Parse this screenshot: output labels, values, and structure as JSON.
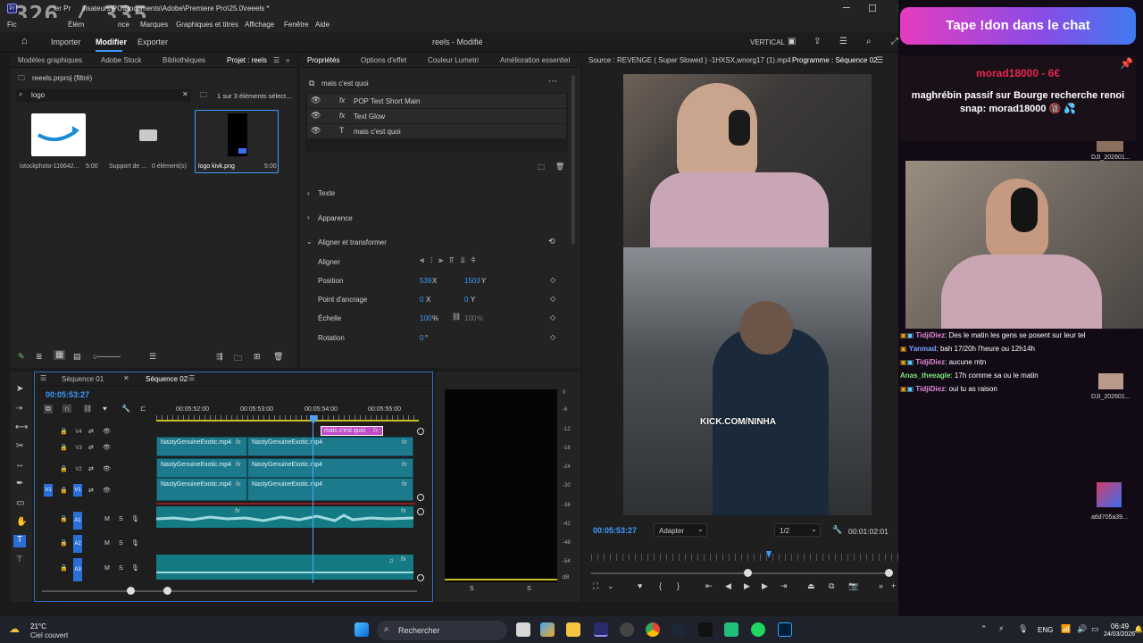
{
  "overlay": {
    "counter": "326 / 335"
  },
  "window": {
    "title_fragment": "ilisateurs\\PC\\Documents\\Adobe\\Premiere Pro\\25.0\\reeels *",
    "prefix": "ier Pr"
  },
  "menu": {
    "items": [
      "Fic",
      "Élém",
      "nce",
      "Marques",
      "Graphiques et titres",
      "Affichage",
      "Fenêtre",
      "Aide"
    ]
  },
  "workspace": {
    "tabs": [
      "Importer",
      "Modifier",
      "Exporter"
    ],
    "project_title": "reels - Modifié",
    "layout": "VERTICAL"
  },
  "project_panel": {
    "tabs": [
      "Modèles graphiques",
      "Adobe Stock",
      "Bibliothèques",
      "Projet : reels"
    ],
    "project_file": "reeels.prproj (filtré)",
    "search_value": "logo",
    "count_text": "1 sur 3 éléments sélect...",
    "items": [
      {
        "name": "istockphoto-116642...",
        "duration": "5:00"
      },
      {
        "name": "Support de ...",
        "duration": "0 élément(s)"
      },
      {
        "name": "logo kivk.png",
        "duration": "5:00"
      }
    ]
  },
  "properties": {
    "tabs": [
      "Propriétés",
      "Options d'effet",
      "Couleur Lumetri",
      "Amélioration essentiel"
    ],
    "clip_name": "mais c'est quoi",
    "layers": [
      "POP Text Short Main",
      "Text Glow",
      "mais c'est quoi"
    ],
    "sections": [
      "Texte",
      "Apparence",
      "Aligner et transformer"
    ],
    "fields": [
      {
        "label": "Aligner",
        "x": "",
        "y": ""
      },
      {
        "label": "Position",
        "x": "539",
        "xu": "X",
        "y": "1503",
        "yu": "Y"
      },
      {
        "label": "Point d'ancrage",
        "x": "0",
        "xu": "X",
        "y": "0",
        "yu": "Y"
      },
      {
        "label": "Échelle",
        "x": "100",
        "xu": "%",
        "y": "100",
        "yu": "%"
      },
      {
        "label": "Rotation",
        "x": "0",
        "xu": "°",
        "y": "",
        "yu": ""
      }
    ]
  },
  "timeline": {
    "tabs": [
      "Séquence 01",
      "Séquence 02"
    ],
    "timecode": "00:05:53:27",
    "ruler": [
      "00:05:52:00",
      "00:05:53:00",
      "00:05:54:00",
      "00:05:55:00"
    ],
    "tracks": [
      "V4",
      "V3",
      "V2",
      "V1",
      "A1",
      "A2",
      "A3"
    ],
    "source_patch": [
      "V1",
      "A1",
      "A2",
      "A3"
    ],
    "clip_name": "NastyGenuineExotic.mp4",
    "text_clip": "mais c'est quoi",
    "meter_scale": [
      "0",
      "-6",
      "-12",
      "-18",
      "-24",
      "-30",
      "-36",
      "-42",
      "-48",
      "-54",
      "dB"
    ],
    "meter_bottom": [
      "S",
      "S"
    ]
  },
  "monitor": {
    "source_tab": "Source : REVENGE ( Super Slowed ) -1HXSX,wnorg17 (1).mp4",
    "program_tab": "Programme : Séquence 02",
    "video_overlay": "KICK.COM/NINHA",
    "timecode": "00:05:53:27",
    "fit": "Adapter",
    "resolution": "1/2",
    "duration": "00:01:02:01"
  },
  "stream": {
    "banner": "Tape !don dans le chat",
    "donation_header": "morad18000 - 6€",
    "donation_message": "maghrébin passif sur Bourge recherche renoi snap: morad18000 🔞 💦",
    "side_label_1": "DJI_202601...",
    "side_label_2": "DJI_202601...",
    "side_label_3": "a6d705a39...",
    "chat": [
      {
        "user": "TidjiDiez",
        "color": "#e08ad8",
        "msg": "Des le matin les gens se posent sur leur tel"
      },
      {
        "user": "Yanmad",
        "color": "#7aa2ff",
        "msg": "bah 17/20h l'heure ou 12h14h"
      },
      {
        "user": "TidjiDiez",
        "color": "#e08ad8",
        "msg": "aucune mtn"
      },
      {
        "user": "Anas_theeagle",
        "color": "#7ee87e",
        "msg": "17h comme sa ou le matin"
      },
      {
        "user": "TidjiDiez",
        "color": "#e08ad8",
        "msg": "oui tu as raison"
      }
    ]
  },
  "taskbar": {
    "weather_temp": "21°C",
    "weather_desc": "Ciel couvert",
    "search": "Rechercher",
    "lang": "ENG",
    "time": "06:49",
    "date": "24/03/2026"
  },
  "colors": {
    "accent": "#2a6fd6",
    "clip": "#1d7a8c",
    "playhead": "#4da3ff",
    "text_clip": "#c04ac8"
  }
}
